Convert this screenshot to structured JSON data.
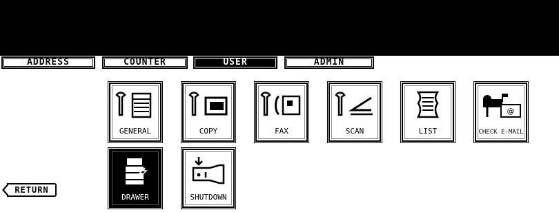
{
  "tabs": [
    {
      "label": "ADDRESS",
      "selected": false
    },
    {
      "label": "COUNTER",
      "selected": false
    },
    {
      "label": "USER",
      "selected": true
    },
    {
      "label": "ADMIN",
      "selected": false
    }
  ],
  "buttons": {
    "general": {
      "label": "GENERAL",
      "icon": "wrench-copier-icon"
    },
    "copy": {
      "label": "COPY",
      "icon": "wrench-copy-icon"
    },
    "fax": {
      "label": "FAX",
      "icon": "wrench-fax-icon"
    },
    "scan": {
      "label": "SCAN",
      "icon": "wrench-scan-icon"
    },
    "list": {
      "label": "LIST",
      "icon": "list-scroll-icon"
    },
    "check_email": {
      "label": "CHECK E-MAIL",
      "icon": "mailbox-icon"
    },
    "drawer": {
      "label": "DRAWER",
      "icon": "drawer-icon",
      "selected": true
    },
    "shutdown": {
      "label": "SHUTDOWN",
      "icon": "power-switch-icon"
    }
  },
  "return_label": "RETURN",
  "colors": {
    "background": "#000000",
    "panel": "#ffffff",
    "selected": "#000000"
  }
}
